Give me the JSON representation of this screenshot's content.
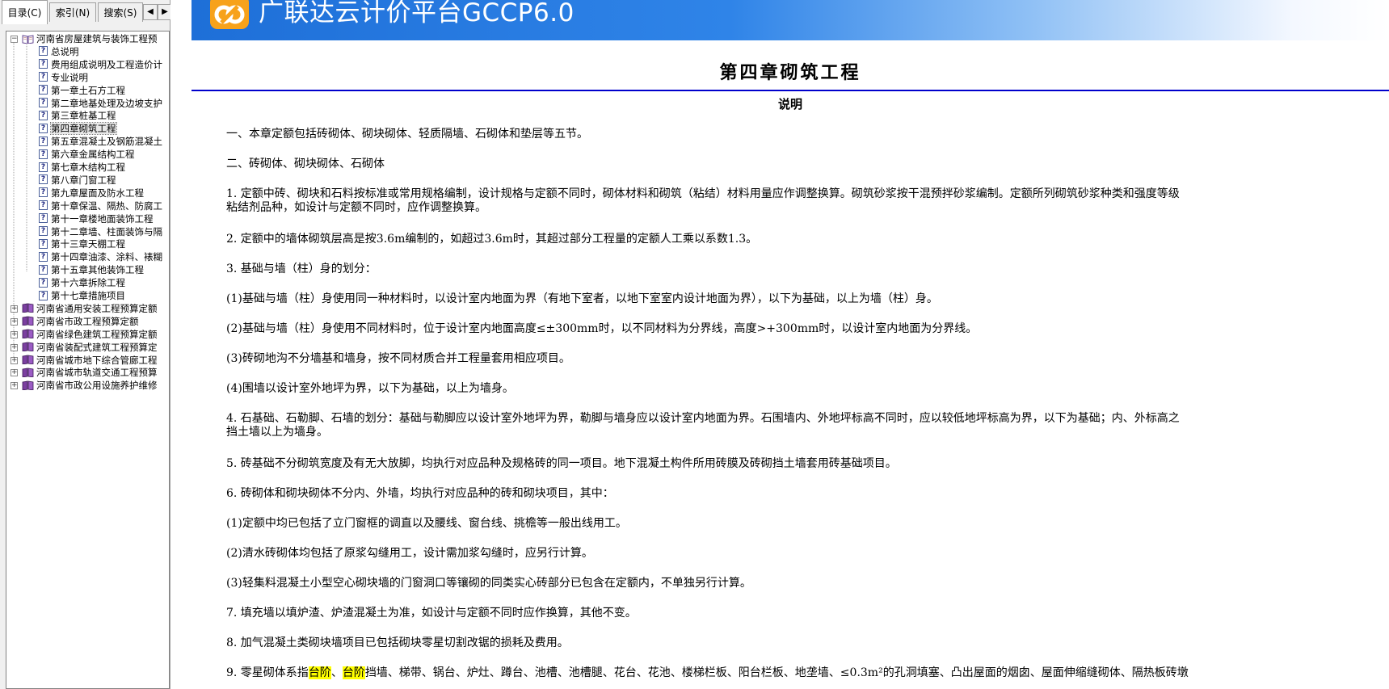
{
  "tabs": [
    {
      "label": "目录(C)",
      "active": true
    },
    {
      "label": "索引(N)",
      "active": false
    },
    {
      "label": "搜索(S)",
      "active": false
    }
  ],
  "tab_scroll": {
    "left": "◀",
    "right": "▶"
  },
  "tree": {
    "root": {
      "label": "河南省房屋建筑与装饰工程预",
      "expander": "−"
    },
    "children": [
      "总说明",
      "费用组成说明及工程造价计",
      "专业说明",
      "第一章土石方工程",
      "第二章地基处理及边坡支护",
      "第三章桩基工程",
      "第四章砌筑工程",
      "第五章混凝土及钢筋混凝土",
      "第六章金属结构工程",
      "第七章木结构工程",
      "第八章门窗工程",
      "第九章屋面及防水工程",
      "第十章保温、隔热、防腐工",
      "第十一章楼地面装饰工程",
      "第十二章墙、柱面装饰与隔",
      "第十三章天棚工程",
      "第十四章油漆、涂料、裱糊",
      "第十五章其他装饰工程",
      "第十六章拆除工程",
      "第十七章措施项目"
    ],
    "selected_child": "第四章砌筑工程",
    "other_books": [
      "河南省通用安装工程预算定额",
      "河南省市政工程预算定额",
      "河南省绿色建筑工程预算定额",
      "河南省装配式建筑工程预算定",
      "河南省城市地下综合管廊工程",
      "河南省城市轨道交通工程预算",
      "河南省市政公用设施养护维修"
    ],
    "collapsed_expander": "+",
    "help_glyph": "?"
  },
  "banner": {
    "title": "广联达云计价平台GCCP6.0",
    "logo_icon": "glodon-logo-icon",
    "colors": {
      "start": "#1e6fd8",
      "end": "#ffffff",
      "logo": "#f7a21b"
    }
  },
  "doc": {
    "chapter_title": "第四章砌筑工程",
    "section_title": "说明",
    "paragraphs": [
      [
        "一、本章定额包括砖砌体、砌块砌体、轻质隔墙、石砌体和垫层等五节。"
      ],
      [
        "二、砖砌体、砌块砌体、石砌体"
      ],
      [
        "1. 定额中砖、砌块和石料按标准或常用规格编制，设计规格与定额不同时，砌体材料和砌筑（粘结）材料用量应作调整换算。砌筑砂浆按干混预拌砂浆编制。定额所列砌筑砂浆种类和强度等级",
        "粘结剂品种，如设计与定额不同时，应作调整换算。"
      ],
      [
        "2. 定额中的墙体砌筑层高是按3.6m编制的，如超过3.6m时，其超过部分工程量的定额人工乘以系数1.3。"
      ],
      [
        "3. 基础与墙（柱）身的划分："
      ],
      [
        "(1)基础与墙（柱）身使用同一种材料时，以设计室内地面为界（有地下室者，以地下室室内设计地面为界），以下为基础，以上为墙（柱）身。"
      ],
      [
        "(2)基础与墙（柱）身使用不同材料时，位于设计室内地面高度≤±300mm时，以不同材料为分界线，高度>+300mm时，以设计室内地面为分界线。"
      ],
      [
        "(3)砖砌地沟不分墙基和墙身，按不同材质合并工程量套用相应项目。"
      ],
      [
        "(4)围墙以设计室外地坪为界，以下为基础，以上为墙身。"
      ],
      [
        "4. 石基础、石勒脚、石墙的划分：基础与勒脚应以设计室外地坪为界，勒脚与墙身应以设计室内地面为界。石围墙内、外地坪标高不同时，应以较低地坪标高为界，以下为基础；内、外标高之",
        "挡土墙以上为墙身。"
      ],
      [
        "5. 砖基础不分砌筑宽度及有无大放脚，均执行对应品种及规格砖的同一项目。地下混凝土构件所用砖膜及砖砌挡土墙套用砖基础项目。"
      ],
      [
        "6. 砖砌体和砌块砌体不分内、外墙，均执行对应品种的砖和砌块项目，其中："
      ],
      [
        "(1)定额中均已包括了立门窗框的调直以及腰线、窗台线、挑檐等一般出线用工。"
      ],
      [
        "(2)清水砖砌体均包括了原浆勾缝用工，设计需加浆勾缝时，应另行计算。"
      ],
      [
        "(3)轻集料混凝土小型空心砌块墙的门窗洞口等镶砌的同类实心砖部分已包含在定额内，不单独另行计算。"
      ],
      [
        "7. 填充墙以填炉渣、炉渣混凝土为准，如设计与定额不同时应作换算，其他不变。"
      ],
      [
        "8. 加气混凝土类砌块墙项目已包括砌块零星切割改锯的损耗及费用。"
      ]
    ],
    "last_paragraph": {
      "before": "9. 零星砌体系指",
      "highlight_1": "台阶",
      "sep": "、",
      "highlight_2": "台阶",
      "after": "挡墙、梯带、锅台、炉灶、蹲台、池槽、池槽腿、花台、花池、楼梯栏板、阳台栏板、地垄墙、≤0.3m²的孔洞填塞、凸出屋面的烟囱、屋面伸缩缝砌体、隔热板砖墩"
    },
    "highlight_color": "#ffff00"
  }
}
